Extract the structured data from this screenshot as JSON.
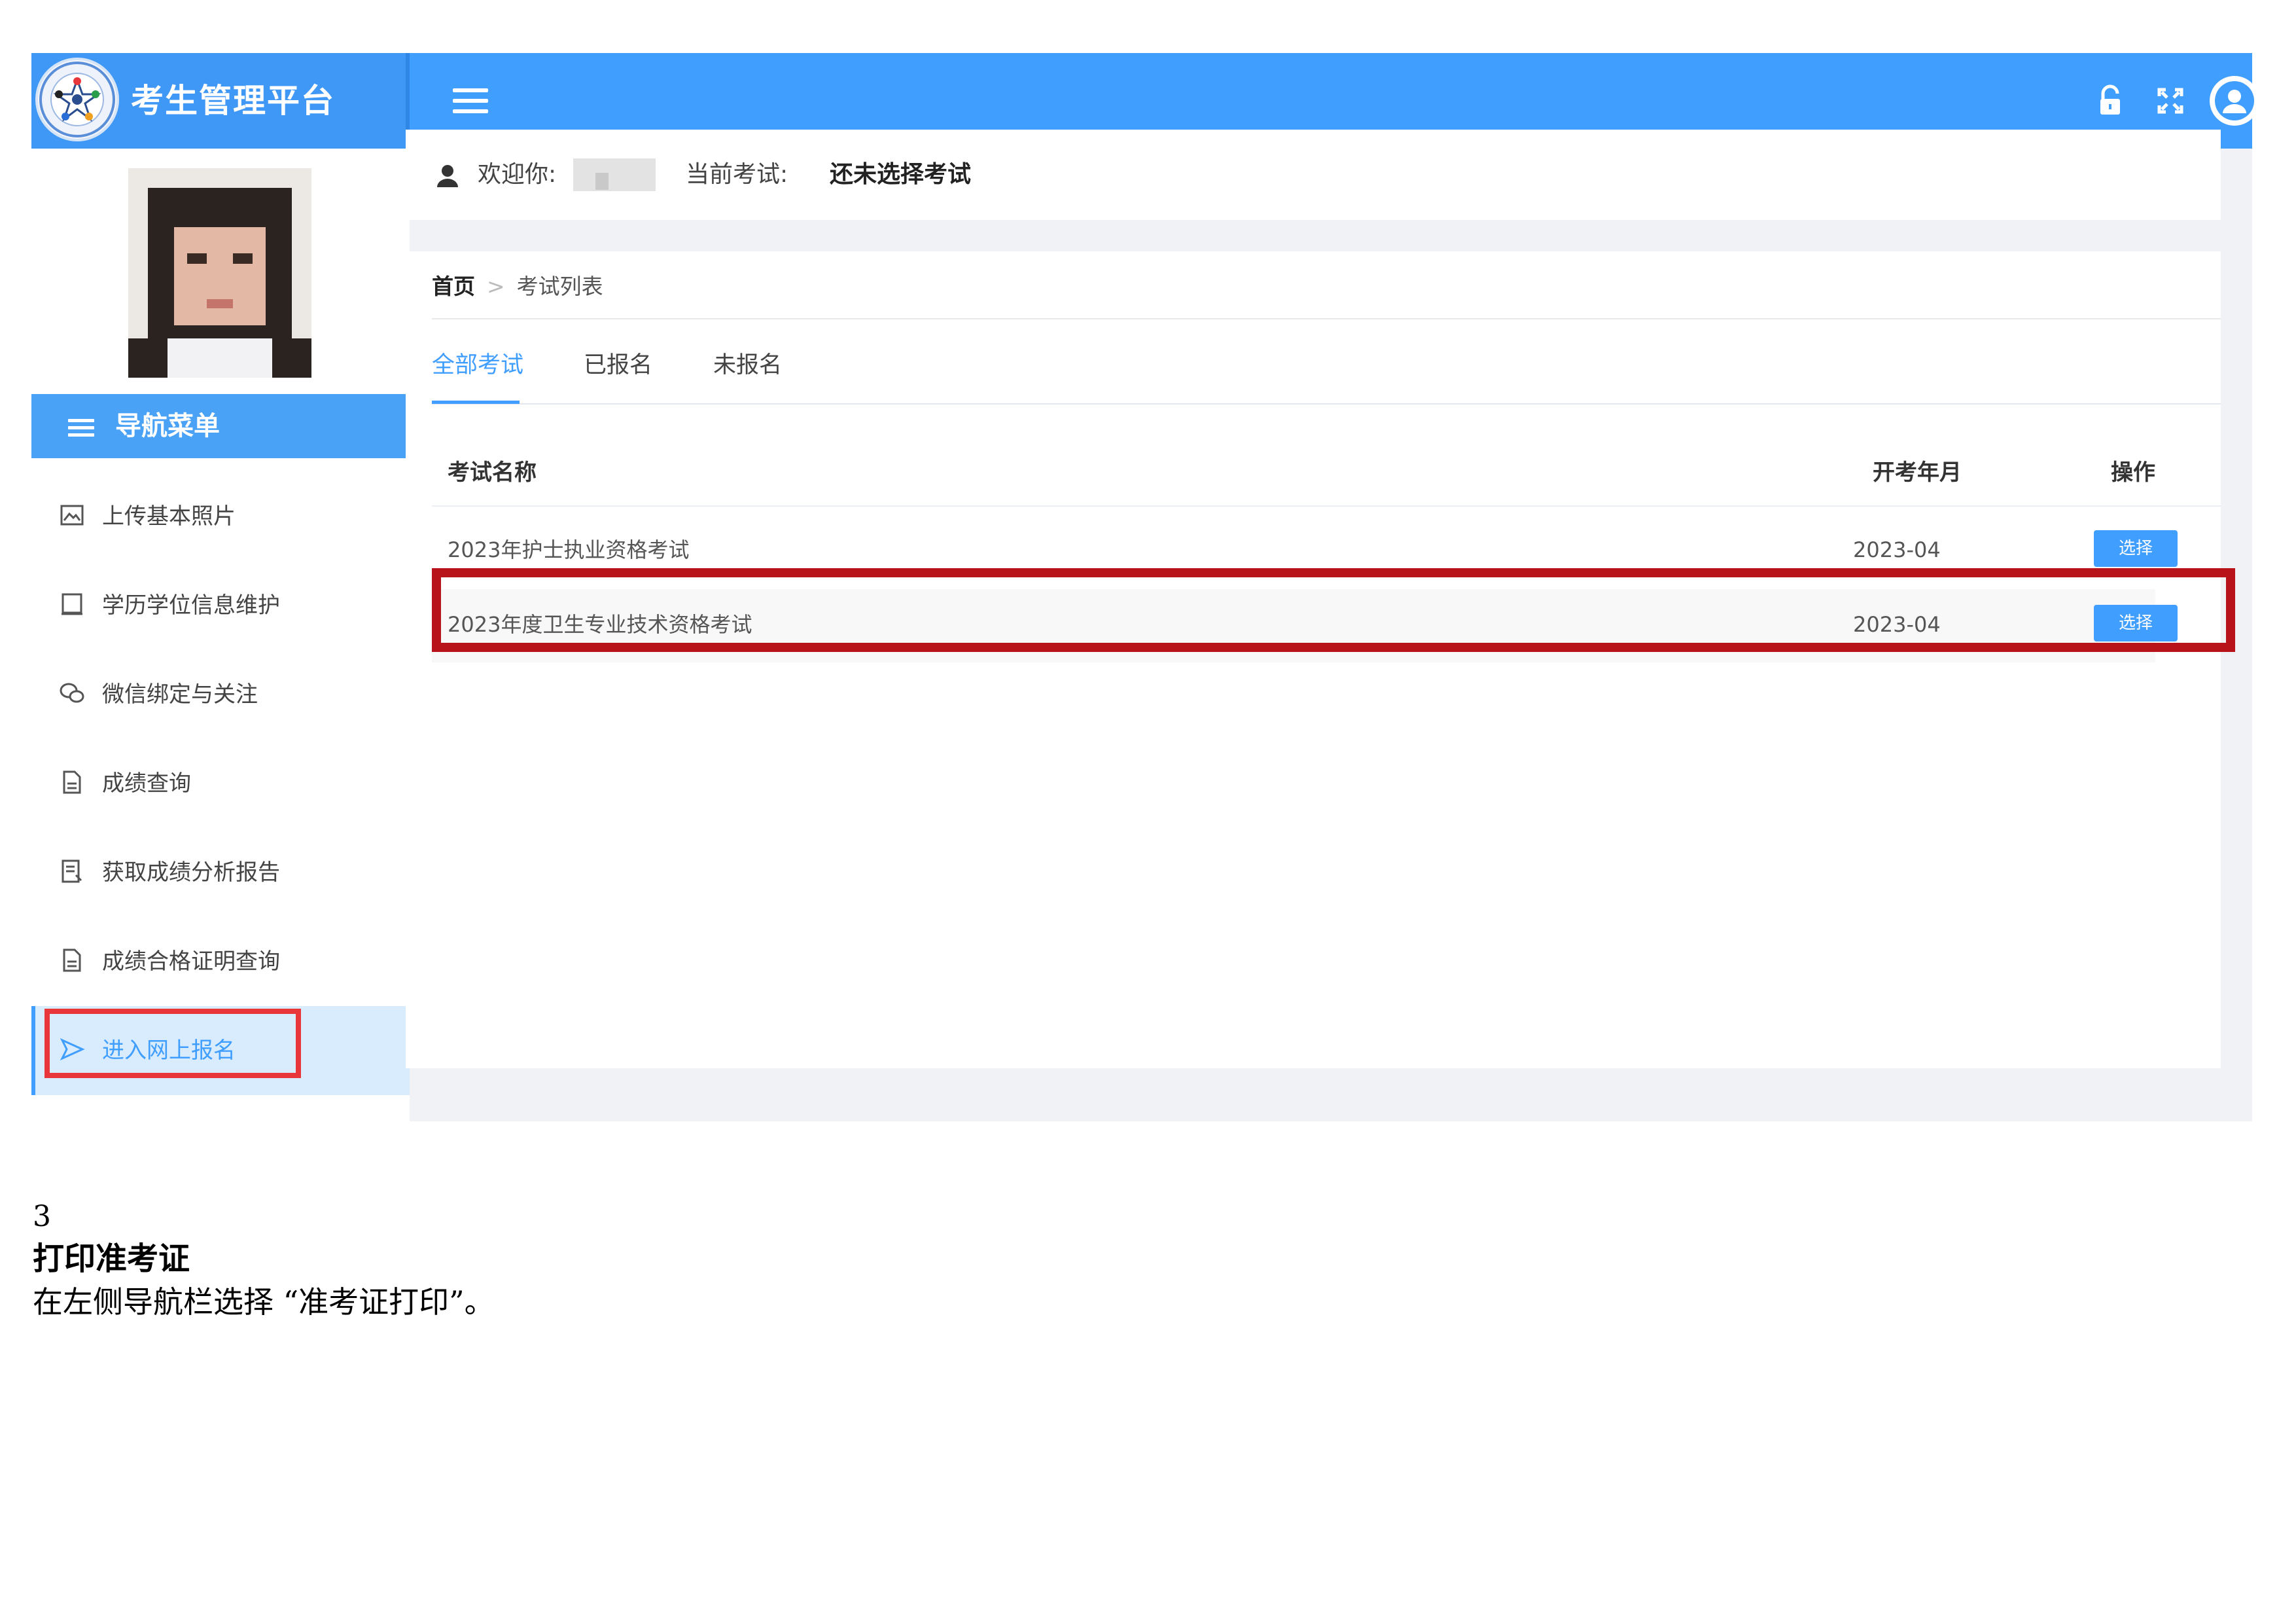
{
  "header": {
    "app_title": "考生管理平台",
    "icons": [
      "logo-emblem",
      "menu-icon",
      "lock-icon",
      "fullscreen-icon",
      "user-circle-icon"
    ]
  },
  "colors": {
    "header_bg": "#409eff",
    "accent": "#409eff",
    "highlight_red": "#b8121a",
    "nav_highlight_red": "#e8363b",
    "active_bg": "#d9ecfd"
  },
  "sidebar": {
    "nav_title": "导航菜单",
    "items": [
      {
        "label": "上传基本照片",
        "icon": "image-icon"
      },
      {
        "label": "学历学位信息维护",
        "icon": "book-icon"
      },
      {
        "label": "微信绑定与关注",
        "icon": "wechat-icon"
      },
      {
        "label": "成绩查询",
        "icon": "document-icon"
      },
      {
        "label": "获取成绩分析报告",
        "icon": "report-icon"
      },
      {
        "label": "成绩合格证明查询",
        "icon": "document-icon"
      },
      {
        "label": "进入网上报名",
        "icon": "send-icon",
        "active": true
      }
    ]
  },
  "welcome": {
    "greeting": "欢迎你:",
    "current_exam_label": "当前考试:",
    "current_exam_value": "还未选择考试"
  },
  "breadcrumb": {
    "home": "首页",
    "separator": ">",
    "current": "考试列表"
  },
  "tabs": [
    {
      "label": "全部考试",
      "active": true
    },
    {
      "label": "已报名",
      "active": false
    },
    {
      "label": "未报名",
      "active": false
    }
  ],
  "table": {
    "headers": {
      "name": "考试名称",
      "date": "开考年月",
      "action": "操作"
    },
    "rows": [
      {
        "name": "2023年护士执业资格考试",
        "date": "2023-04",
        "action": "选择"
      },
      {
        "name": "2023年度卫生专业技术资格考试",
        "date": "2023-04",
        "action": "选择"
      }
    ]
  },
  "doc": {
    "step_number": "3",
    "heading": "打印准考证",
    "body": "在左侧导航栏选择 “准考证打印”。"
  }
}
